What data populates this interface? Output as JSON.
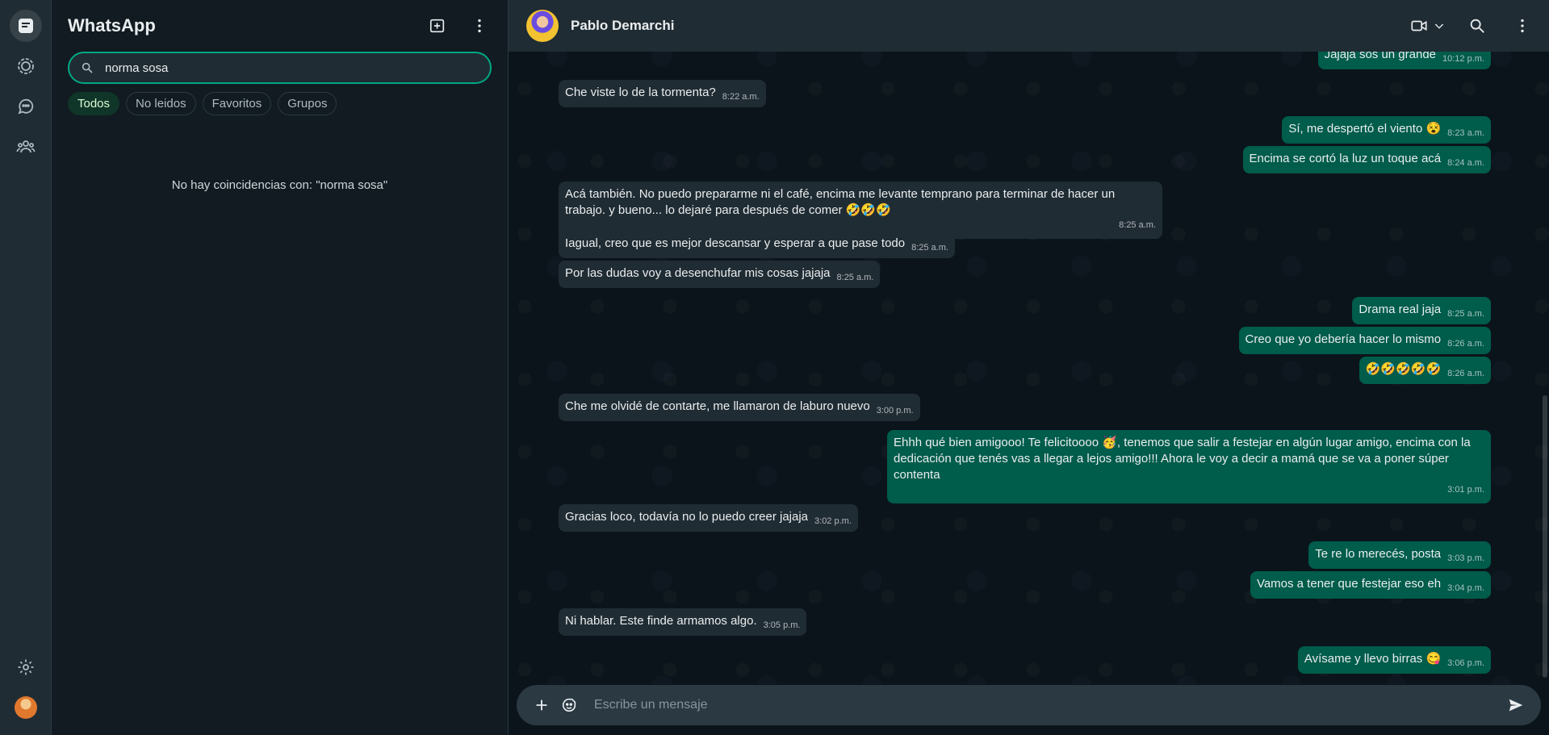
{
  "app": {
    "title": "WhatsApp"
  },
  "search": {
    "value": "norma sosa",
    "no_results": "No hay coincidencias con: \"norma sosa\""
  },
  "filters": [
    {
      "label": "Todos",
      "active": true
    },
    {
      "label": "No leidos",
      "active": false
    },
    {
      "label": "Favoritos",
      "active": false
    },
    {
      "label": "Grupos",
      "active": false
    }
  ],
  "chat": {
    "contact_name": "Pablo Demarchi",
    "composer_placeholder": "Escribe un mensaje"
  },
  "messages": [
    {
      "dir": "out",
      "text": "Jajaja sos un grande",
      "time": "10:12 p.m."
    },
    {
      "dir": "in",
      "text": "Che viste lo de la tormenta?",
      "time": "8:22 a.m."
    },
    {
      "dir": "out",
      "text": "Sí, me despertó el viento 😵",
      "time": "8:23 a.m."
    },
    {
      "dir": "out",
      "text": "Encima se cortó la luz un toque acá",
      "time": "8:24 a.m."
    },
    {
      "dir": "in",
      "text": "Acá también. No puedo prepararme ni el café, encima me levante temprano para terminar de hacer un trabajo. y bueno... lo dejaré para después de comer 🤣🤣🤣",
      "time": "8:25 a.m."
    },
    {
      "dir": "in",
      "text": "Iagual, creo que es mejor descansar y esperar a que pase todo",
      "time": "8:25 a.m."
    },
    {
      "dir": "in",
      "text": "Por las dudas voy a desenchufar mis cosas jajaja",
      "time": "8:25 a.m."
    },
    {
      "dir": "out",
      "text": "Drama real jaja",
      "time": "8:25 a.m."
    },
    {
      "dir": "out",
      "text": "Creo que yo debería hacer lo mismo",
      "time": "8:26 a.m."
    },
    {
      "dir": "out",
      "text": "🤣🤣🤣🤣🤣",
      "time": "8:26 a.m."
    },
    {
      "dir": "in",
      "text": "Che me olvidé de contarte, me llamaron de laburo nuevo",
      "time": "3:00 p.m."
    },
    {
      "dir": "out",
      "text": "Ehhh qué bien amigooo! Te felicitoooo 🥳, tenemos que salir a festejar en algún lugar amigo, encima con la dedicación que tenés vas a llegar a lejos amigo!!! Ahora le voy a decir a mamá que se va a poner súper contenta",
      "time": "3:01 p.m."
    },
    {
      "dir": "in",
      "text": "Gracias loco, todavía no lo puedo creer jajaja",
      "time": "3:02 p.m."
    },
    {
      "dir": "out",
      "text": "Te re lo merecés, posta",
      "time": "3:03 p.m."
    },
    {
      "dir": "out",
      "text": "Vamos a tener que festejar eso eh",
      "time": "3:04 p.m."
    },
    {
      "dir": "in",
      "text": "Ni hablar. Este finde armamos algo.",
      "time": "3:05 p.m."
    },
    {
      "dir": "out",
      "text": "Avísame y llevo birras 😋",
      "time": "3:06 p.m."
    }
  ],
  "icons": {
    "rail_top": [
      "chats-icon",
      "status-icon",
      "channels-icon",
      "communities-icon"
    ],
    "rail_bottom": [
      "settings-icon"
    ],
    "header": [
      "new-chat-icon",
      "menu-icon"
    ],
    "chat_header": [
      "video-call-icon",
      "chevron-down-icon",
      "search-icon",
      "menu-icon"
    ],
    "composer": [
      "plus-icon",
      "sticker-icon",
      "send-icon"
    ]
  },
  "colors": {
    "accent": "#00a884",
    "outgoing_bubble": "#005c4b",
    "incoming_bubble": "#202c33",
    "panel": "#202c33",
    "background": "#111b21"
  }
}
